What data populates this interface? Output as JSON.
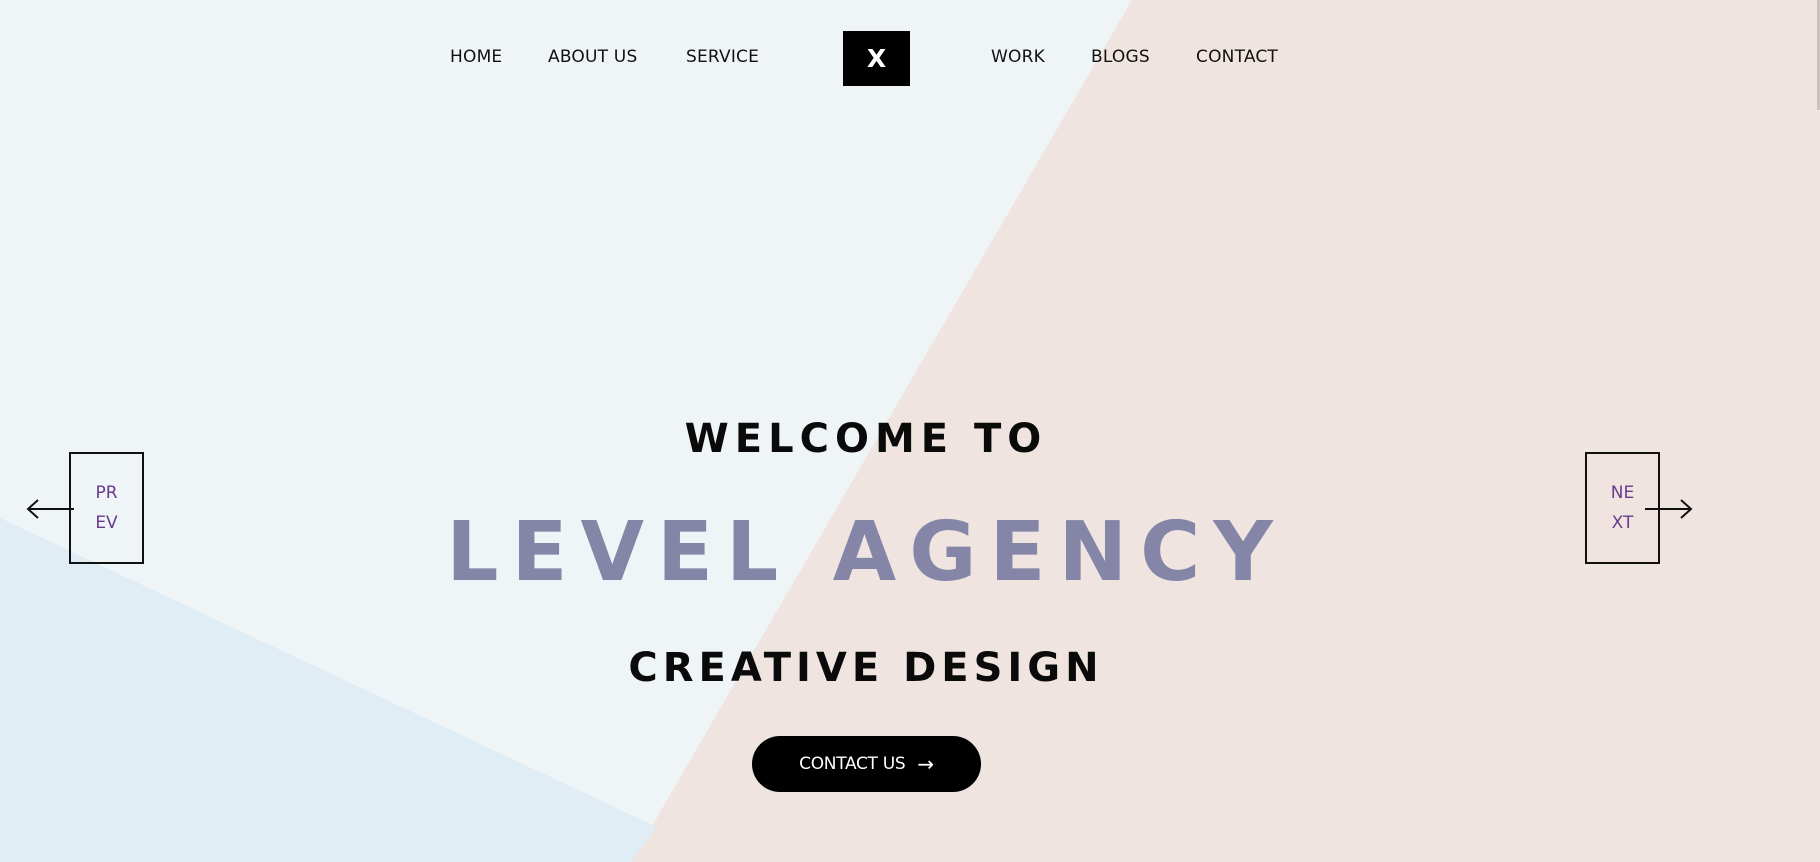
{
  "nav": {
    "left": [
      "HOME",
      "ABOUT US",
      "SERVICE"
    ],
    "right": [
      "WORK",
      "BLOGS",
      "CONTACT"
    ],
    "logo": "X"
  },
  "hero": {
    "welcome": "WELCOME TO",
    "title": "LEVEL AGENCY",
    "subtitle": "CREATIVE DESIGN",
    "cta_label": "CONTACT US",
    "cta_arrow": "→"
  },
  "slider": {
    "prev": [
      "PR",
      "EV"
    ],
    "next": [
      "NE",
      "XT"
    ]
  },
  "colors": {
    "bg_light": "#eff4f7",
    "bg_peach": "#efe4df",
    "bg_blue": "#e1edf4",
    "title_accent": "#8585a8",
    "slider_text": "#6a3a8f"
  },
  "icons": {
    "prev": "arrow-left-icon",
    "next": "arrow-right-icon"
  }
}
